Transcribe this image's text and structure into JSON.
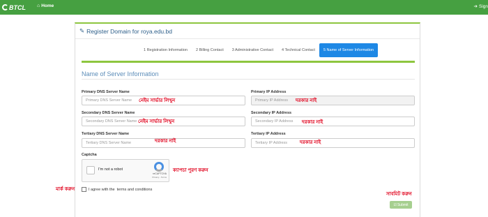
{
  "navbar": {
    "brand": "BTCL",
    "home_label": "Home",
    "signin_label": "Sign"
  },
  "panel": {
    "title": "Register Domain for roya.edu.bd"
  },
  "wizard": {
    "steps": [
      "1 Registration Information",
      "2 Billing Contact",
      "3 Administrative Contact",
      "4 Technical Contact",
      "5 Name of Server Information"
    ],
    "active_index": 4
  },
  "section": {
    "title": "Name of Server Information"
  },
  "form": {
    "primary_dns_label": "Primary DNS Server Name",
    "primary_dns_placeholder": "Primary DNS Server Name",
    "primary_ip_label": "Primary IP Address",
    "primary_ip_placeholder": "Primary IP Address",
    "secondary_dns_label": "Secondary DNS Server Name",
    "secondary_dns_placeholder": "Secondary DNS Server Name",
    "secondary_ip_label": "Secondary IP Address",
    "secondary_ip_placeholder": "Secondary IP Address",
    "tertiary_dns_label": "Tertiary DNS Server Name",
    "tertiary_dns_placeholder": "Tertiary DNS Server Name",
    "tertiary_ip_label": "Tertiary IP Address",
    "tertiary_ip_placeholder": "Tertiary IP Address",
    "captcha_label": "Captcha",
    "captcha_text": "I'm not a robot",
    "recaptcha_name": "reCAPTCHA",
    "recaptcha_links": "Privacy - Terms",
    "agree_prefix": "I agree with the",
    "agree_link": "terms and conditions",
    "submit_label": "Submit"
  },
  "annotations": {
    "write_name_1": "নেইম সার্ভার লিখুন",
    "write_name_2": "নেইম সার্ভার লিখুন",
    "not_needed_1": "দরকার নাই",
    "not_needed_2": "দরকার নাই",
    "not_needed_3": "দরকার নাই",
    "not_needed_4": "দরকার নাই",
    "fill_captcha": "ক্যাপচা পুরণ করুন",
    "mark": "মার্ক করুন",
    "submit_note": "সাবমিট করুন"
  },
  "colors": {
    "navbar": "#46a041",
    "active_step": "#1e88e5",
    "annotation": "#e0001b",
    "accent": "#8dc63f"
  }
}
